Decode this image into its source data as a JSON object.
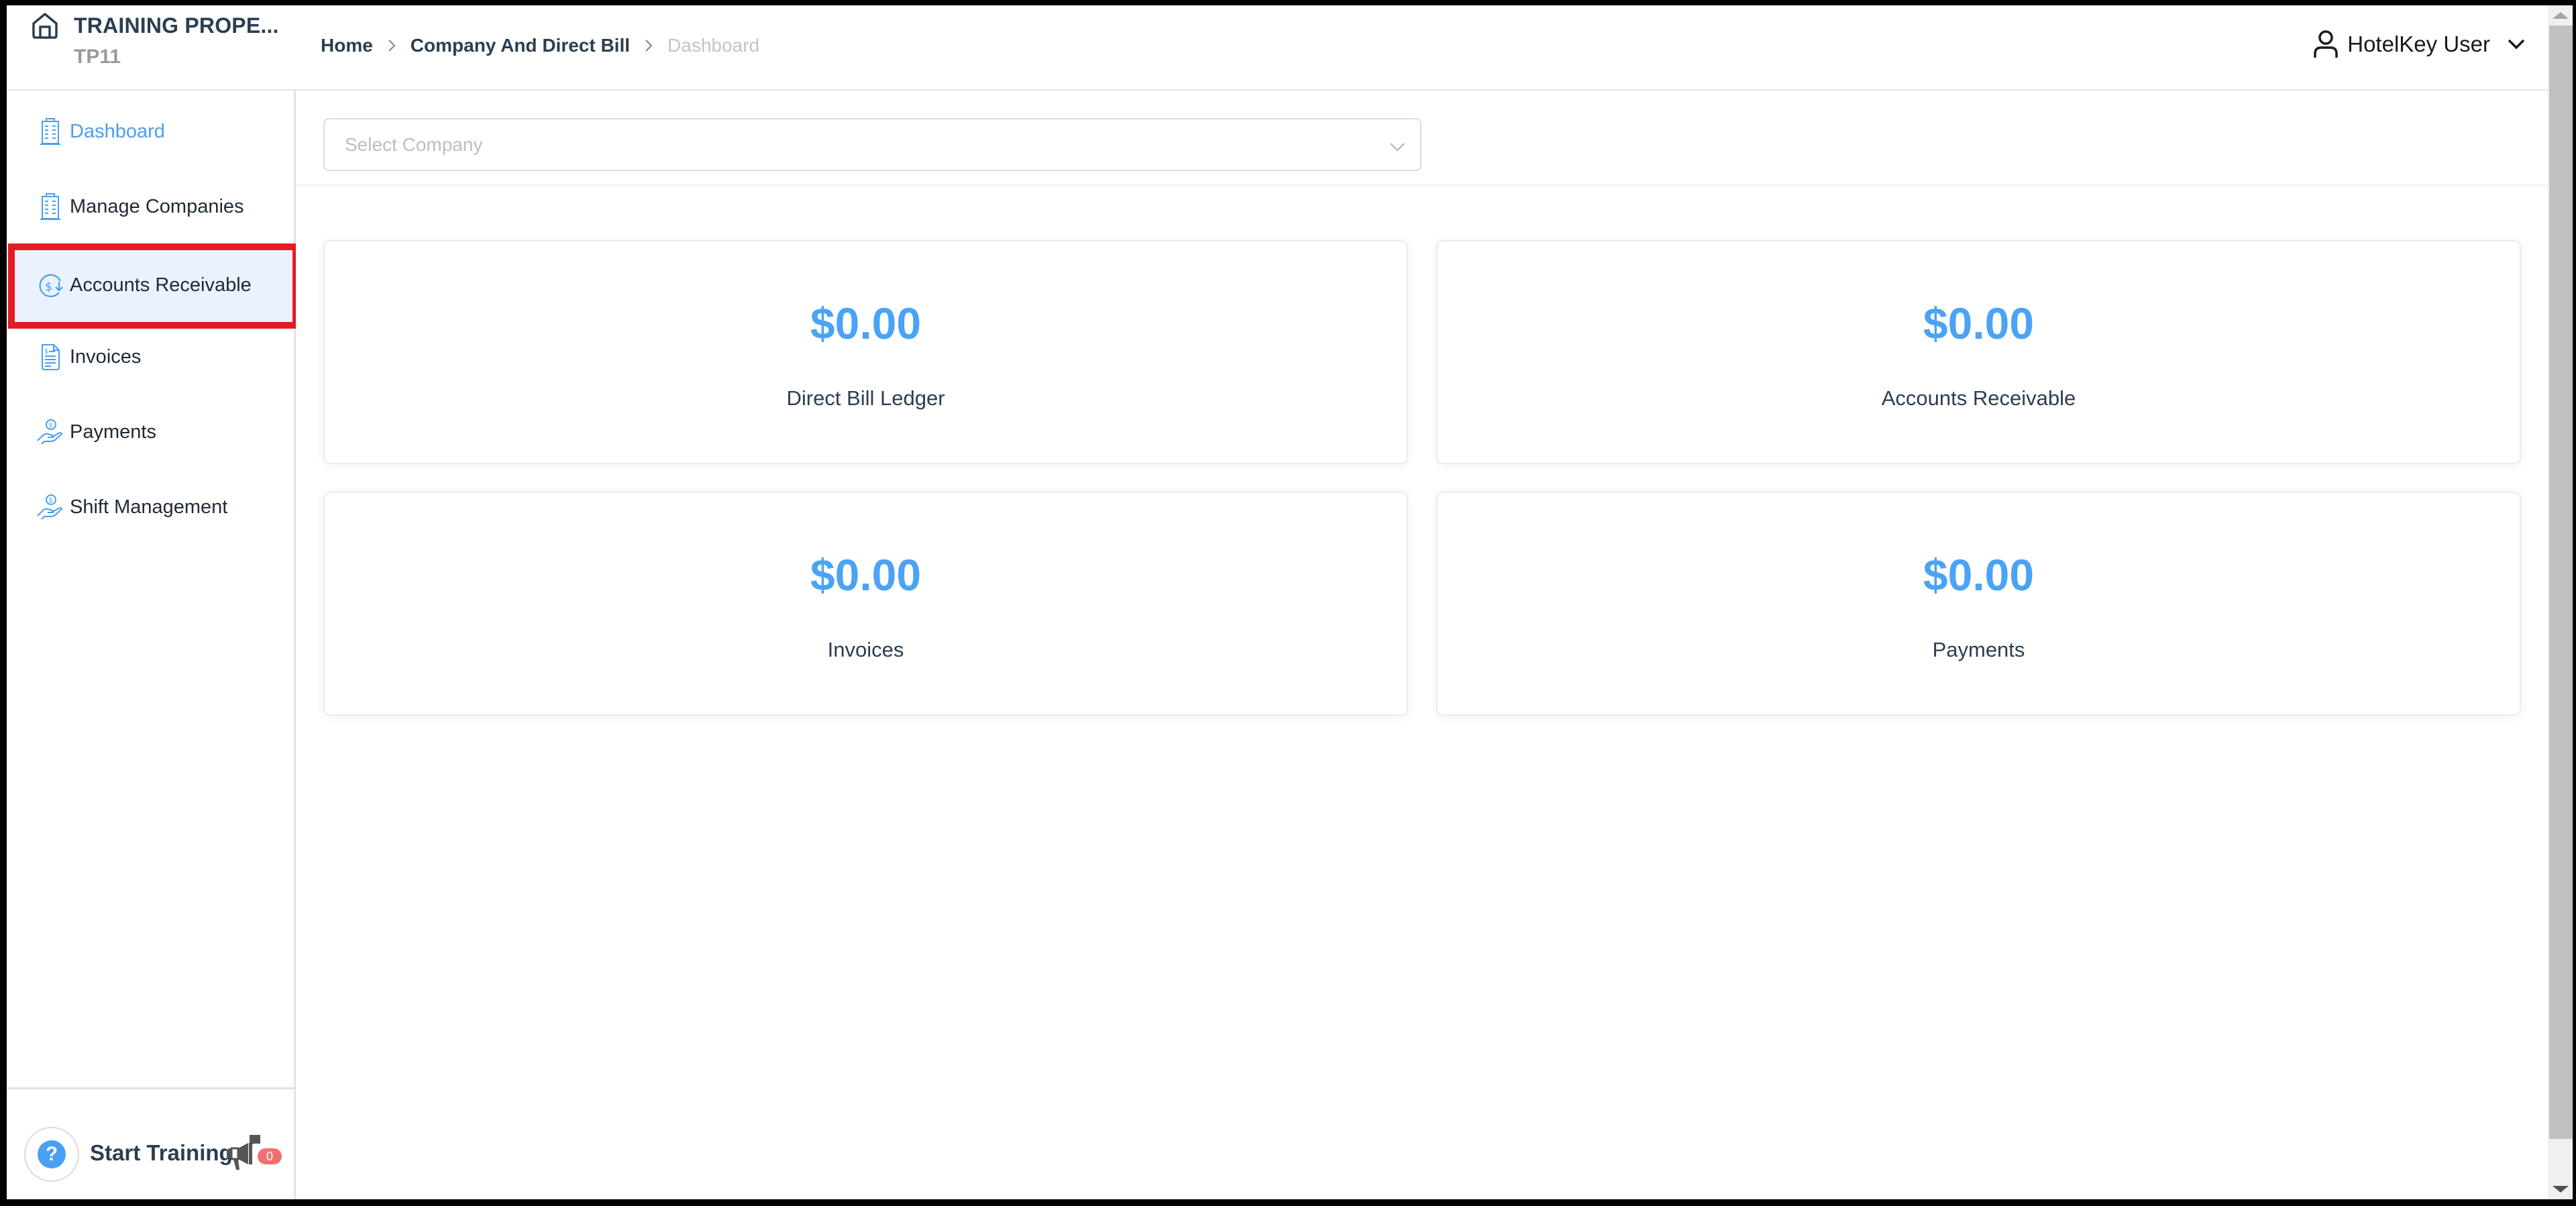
{
  "header": {
    "property_name": "TRAINING PROPE...",
    "property_code": "TP11",
    "breadcrumb": [
      {
        "label": "Home"
      },
      {
        "label": "Company And Direct Bill"
      },
      {
        "label": "Dashboard"
      }
    ],
    "user_name": "HotelKey User"
  },
  "sidebar": {
    "items": [
      {
        "label": "Dashboard",
        "icon": "building-icon",
        "state": "active"
      },
      {
        "label": "Manage Companies",
        "icon": "building-icon"
      },
      {
        "label": "Accounts Receivable",
        "icon": "dollar-refresh-icon",
        "state": "highlighted"
      },
      {
        "label": "Invoices",
        "icon": "invoice-document-icon"
      },
      {
        "label": "Payments",
        "icon": "hand-coin-icon"
      },
      {
        "label": "Shift Management",
        "icon": "hand-coin-icon"
      }
    ],
    "footer": {
      "help_glyph": "?",
      "start_training_label": "Start Training",
      "notification_count": "0"
    }
  },
  "main": {
    "select_company": {
      "placeholder": "Select Company",
      "value": ""
    },
    "cards": [
      {
        "amount": "$0.00",
        "label": "Direct Bill Ledger"
      },
      {
        "amount": "$0.00",
        "label": "Accounts Receivable"
      },
      {
        "amount": "$0.00",
        "label": "Invoices"
      },
      {
        "amount": "$0.00",
        "label": "Payments"
      }
    ]
  },
  "colors": {
    "accent": "#4a9ef3",
    "amount": "#4aa3f5",
    "text_dark": "#2c3e50",
    "highlight_bg": "#eaf3fd",
    "highlight_outline": "#e31b23",
    "badge": "#f07070"
  }
}
